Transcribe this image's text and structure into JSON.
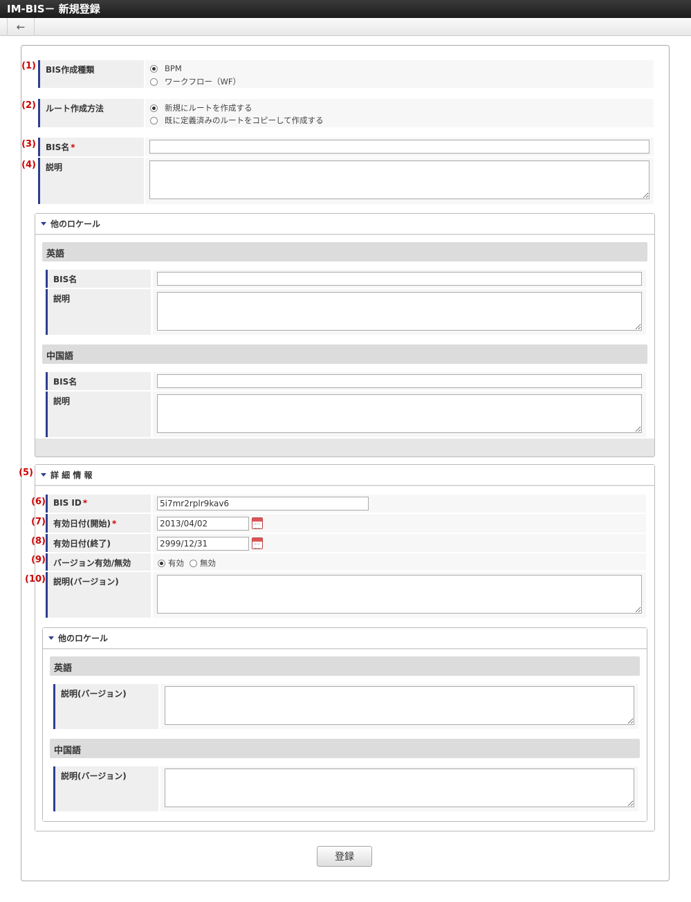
{
  "window": {
    "title": "IM-BIS－ 新規登録"
  },
  "toolbar": {
    "back_icon": "←"
  },
  "form": {
    "creation_type": {
      "num": "(1)",
      "label": "BIS作成種類",
      "options": [
        "BPM",
        "ワークフロー（WF）"
      ],
      "selected": "BPM"
    },
    "route_method": {
      "num": "(2)",
      "label": "ルート作成方法",
      "options": [
        "新規にルートを作成する",
        "既に定義済みのルートをコピーして作成する"
      ],
      "selected": "新規にルートを作成する"
    },
    "bis_name": {
      "num": "(3)",
      "label": "BIS名",
      "required": "*",
      "value": ""
    },
    "description": {
      "num": "(4)",
      "label": "説明",
      "value": ""
    },
    "other_locale": {
      "title": "他のロケール",
      "english": {
        "title": "英語",
        "name_label": "BIS名",
        "desc_label": "説明"
      },
      "chinese": {
        "title": "中国語",
        "name_label": "BIS名",
        "desc_label": "説明"
      }
    },
    "detail": {
      "num": "(5)",
      "title": "詳 細 情 報",
      "bis_id": {
        "num": "(6)",
        "label": "BIS ID",
        "required": "*",
        "value": "5i7mr2rplr9kav6"
      },
      "start_date": {
        "num": "(7)",
        "label": "有効日付(開始)",
        "required": "*",
        "value": "2013/04/02"
      },
      "end_date": {
        "num": "(8)",
        "label": "有効日付(終了)",
        "value": "2999/12/31"
      },
      "version_enabled": {
        "num": "(9)",
        "label": "バージョン有効/無効",
        "options": [
          "有効",
          "無効"
        ],
        "selected": "有効"
      },
      "version_desc": {
        "num": "(10)",
        "label": "説明(バージョン)"
      },
      "other_locale": {
        "title": "他のロケール",
        "english": {
          "title": "英語",
          "desc_label": "説明(バージョン)"
        },
        "chinese": {
          "title": "中国語",
          "desc_label": "説明(バージョン)"
        }
      }
    },
    "submit_label": "登録"
  },
  "colors": {
    "accent": "#2c3f8f",
    "required": "#cc0000"
  }
}
